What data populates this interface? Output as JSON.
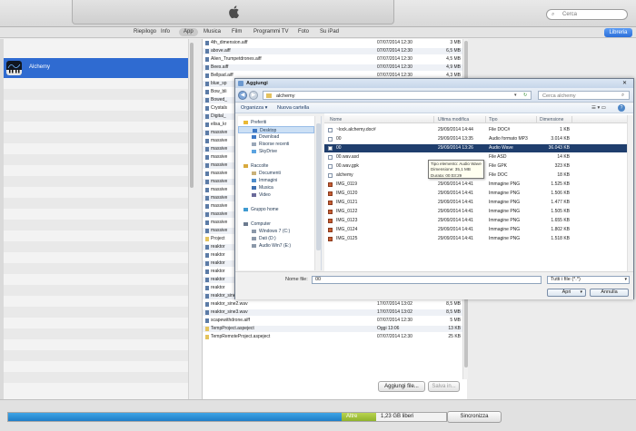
{
  "toolbar": {
    "search_placeholder": "Cerca"
  },
  "tabs": [
    {
      "label": "Riepilogo",
      "active": false
    },
    {
      "label": "Info",
      "active": false
    },
    {
      "label": "App",
      "active": true
    },
    {
      "label": "Musica",
      "active": false
    },
    {
      "label": "Film",
      "active": false
    },
    {
      "label": "Programmi TV",
      "active": false
    },
    {
      "label": "Foto",
      "active": false
    },
    {
      "label": "Su iPad",
      "active": false
    }
  ],
  "library_button": "Libreria",
  "apps_list": {
    "selected_app": "Alchemy"
  },
  "documents": [
    {
      "name": "4th_dimension.aiff",
      "date": "07/07/2014 12:30",
      "size": "3 MB"
    },
    {
      "name": "above.aiff",
      "date": "07/07/2014 12:30",
      "size": "6,5 MB"
    },
    {
      "name": "Alien_Trumpetdrones.aiff",
      "date": "07/07/2014 12:30",
      "size": "4,5 MB"
    },
    {
      "name": "Bees.aiff",
      "date": "07/07/2014 12:30",
      "size": "4,9 MB"
    },
    {
      "name": "Bellpad.aiff",
      "date": "07/07/2014 12:30",
      "size": "4,3 MB"
    },
    {
      "name": "blue_sp",
      "date": "",
      "size": ""
    },
    {
      "name": "Bow_bli",
      "date": "",
      "size": ""
    },
    {
      "name": "Bowed_",
      "date": "",
      "size": ""
    },
    {
      "name": "Crystals",
      "date": "",
      "size": ""
    },
    {
      "name": "Digital_",
      "date": "",
      "size": ""
    },
    {
      "name": "elisa_kr",
      "date": "",
      "size": ""
    },
    {
      "name": "massive",
      "date": "",
      "size": ""
    },
    {
      "name": "massive",
      "date": "",
      "size": ""
    },
    {
      "name": "massive",
      "date": "",
      "size": ""
    },
    {
      "name": "massive",
      "date": "",
      "size": ""
    },
    {
      "name": "massive",
      "date": "",
      "size": ""
    },
    {
      "name": "massive",
      "date": "",
      "size": ""
    },
    {
      "name": "massive",
      "date": "",
      "size": ""
    },
    {
      "name": "massive",
      "date": "",
      "size": ""
    },
    {
      "name": "massive",
      "date": "",
      "size": ""
    },
    {
      "name": "massive",
      "date": "",
      "size": ""
    },
    {
      "name": "massive",
      "date": "",
      "size": ""
    },
    {
      "name": "massive",
      "date": "",
      "size": ""
    },
    {
      "name": "massive",
      "date": "",
      "size": ""
    },
    {
      "name": "Project",
      "date": "",
      "size": ""
    },
    {
      "name": "reaktor",
      "date": "",
      "size": ""
    },
    {
      "name": "reaktor",
      "date": "",
      "size": ""
    },
    {
      "name": "reaktor",
      "date": "",
      "size": ""
    },
    {
      "name": "reaktor",
      "date": "",
      "size": ""
    },
    {
      "name": "reaktor",
      "date": "",
      "size": ""
    },
    {
      "name": "reaktor",
      "date": "",
      "size": ""
    },
    {
      "name": "reaktor_sine1.wav",
      "date": "17/07/2014 13:02",
      "size": "8,5 MB"
    },
    {
      "name": "reaktor_sine2.wav",
      "date": "17/07/2014 13:02",
      "size": "8,5 MB"
    },
    {
      "name": "reaktor_sine3.wav",
      "date": "17/07/2014 13:02",
      "size": "8,5 MB"
    },
    {
      "name": "scapewithdrone.aiff",
      "date": "07/07/2014 12:30",
      "size": "5 MB"
    },
    {
      "name": "TempProject.aspeject",
      "date": "Oggi 13:06",
      "size": "13 KB"
    },
    {
      "name": "TempRemoteProject.aspeject",
      "date": "07/07/2014 12:30",
      "size": "25 KB"
    }
  ],
  "docs_buttons": {
    "add": "Aggiungi file...",
    "save": "Salva in..."
  },
  "capacity": {
    "other_label": "Altre",
    "free_label": "1,23 GB liberi",
    "sync": "Sincronizza"
  },
  "dialog": {
    "title": "Aggiungi",
    "path": "alchemy",
    "search_placeholder": "Cerca alchemy",
    "organize": "Organizza",
    "new_folder": "Nuova cartella",
    "nav": [
      {
        "label": "Preferiti",
        "level": 0,
        "icon": "star"
      },
      {
        "label": "Desktop",
        "level": 1,
        "icon": "desktop",
        "selected": true
      },
      {
        "label": "Download",
        "level": 1,
        "icon": "download"
      },
      {
        "label": "Risorse recenti",
        "level": 1,
        "icon": "recent"
      },
      {
        "label": "SkyDrive",
        "level": 1,
        "icon": "cloud"
      },
      {
        "label": "",
        "level": -1,
        "icon": ""
      },
      {
        "label": "Raccolte",
        "level": 0,
        "icon": "library"
      },
      {
        "label": "Documenti",
        "level": 1,
        "icon": "documents"
      },
      {
        "label": "Immagini",
        "level": 1,
        "icon": "pictures"
      },
      {
        "label": "Musica",
        "level": 1,
        "icon": "music"
      },
      {
        "label": "Video",
        "level": 1,
        "icon": "video"
      },
      {
        "label": "",
        "level": -1,
        "icon": ""
      },
      {
        "label": "Gruppo home",
        "level": 0,
        "icon": "homegroup"
      },
      {
        "label": "",
        "level": -1,
        "icon": ""
      },
      {
        "label": "Computer",
        "level": 0,
        "icon": "computer"
      },
      {
        "label": "Windows 7 (C:)",
        "level": 1,
        "icon": "drive"
      },
      {
        "label": "Dati (D:)",
        "level": 1,
        "icon": "drive"
      },
      {
        "label": "Audio Win7 (E:)",
        "level": 1,
        "icon": "drive"
      }
    ],
    "columns": {
      "name": "Nome",
      "modified": "Ultima modifica",
      "type": "Tipo",
      "size": "Dimensione"
    },
    "files": [
      {
        "name": "~lock.alchemy.doc#",
        "modified": "29/09/2014 14:44",
        "type": "File DOC#",
        "size": "1 KB",
        "img": false
      },
      {
        "name": "00",
        "modified": "29/09/2014 13:35",
        "type": "Audio formato MP3",
        "size": "3.014 KB",
        "img": false
      },
      {
        "name": "00",
        "modified": "29/09/2014 13:26",
        "type": "Audio Wave",
        "size": "36.043 KB",
        "img": false,
        "selected": true
      },
      {
        "name": "00.wav.asd",
        "modified": "",
        "type": "File ASD",
        "size": "14 KB",
        "img": false
      },
      {
        "name": "00.wav.gpk",
        "modified": "",
        "type": "File GPK",
        "size": "323 KB",
        "img": false
      },
      {
        "name": "alchemy",
        "modified": "29/09/2014 13:35",
        "type": "File DOC",
        "size": "18 KB",
        "img": false
      },
      {
        "name": "IMG_0119",
        "modified": "29/09/2014 14:41",
        "type": "Immagine PNG",
        "size": "1.525 KB",
        "img": true
      },
      {
        "name": "IMG_0120",
        "modified": "29/09/2014 14:41",
        "type": "Immagine PNG",
        "size": "1.506 KB",
        "img": true
      },
      {
        "name": "IMG_0121",
        "modified": "29/09/2014 14:41",
        "type": "Immagine PNG",
        "size": "1.477 KB",
        "img": true
      },
      {
        "name": "IMG_0122",
        "modified": "29/09/2014 14:41",
        "type": "Immagine PNG",
        "size": "1.505 KB",
        "img": true
      },
      {
        "name": "IMG_0123",
        "modified": "29/09/2014 14:41",
        "type": "Immagine PNG",
        "size": "1.655 KB",
        "img": true
      },
      {
        "name": "IMG_0124",
        "modified": "29/09/2014 14:41",
        "type": "Immagine PNG",
        "size": "1.802 KB",
        "img": true
      },
      {
        "name": "IMG_0125",
        "modified": "29/09/2014 14:41",
        "type": "Immagine PNG",
        "size": "1.518 KB",
        "img": true
      }
    ],
    "tooltip": {
      "line1": "Tipo elemento: Audio Wave",
      "line2": "Dimensione: 35,1 MB",
      "line3": "Durata: 00:03:29"
    },
    "filename_label": "Nome file:",
    "filename_value": "00",
    "filetype_value": "Tutti i file (*.*)",
    "open": "Apri",
    "cancel": "Annulla"
  }
}
